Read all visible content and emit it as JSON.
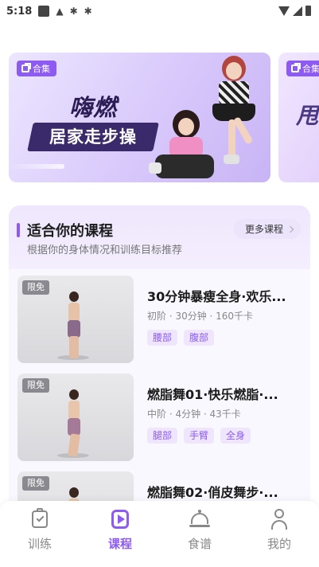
{
  "status_bar": {
    "time": "5:18"
  },
  "banners": [
    {
      "tag": "合集",
      "title": "嗨燃",
      "subtitle": "居家走步操"
    },
    {
      "tag": "合集",
      "title": "甩"
    }
  ],
  "recommend": {
    "title": "适合你的课程",
    "description": "根据你的身体情况和训练目标推荐",
    "more_label": "更多课程",
    "accent_color": "#8d5bf2",
    "items": [
      {
        "badge": "限免",
        "title": "30分钟暴瘦全身·欢乐...",
        "meta": "初阶 · 30分钟 · 160千卡",
        "tags": [
          "腰部",
          "腹部"
        ]
      },
      {
        "badge": "限免",
        "title": "燃脂舞01·快乐燃脂·...",
        "meta": "中阶 · 4分钟 · 43千卡",
        "tags": [
          "腿部",
          "手臂",
          "全身"
        ]
      },
      {
        "badge": "限免",
        "title": "燃脂舞02·俏皮舞步·...",
        "meta": "",
        "tags": []
      }
    ]
  },
  "tabbar": {
    "tabs": [
      {
        "label": "训练",
        "icon": "clipboard-check-icon"
      },
      {
        "label": "课程",
        "icon": "play-square-icon",
        "active": true
      },
      {
        "label": "食谱",
        "icon": "dish-cover-icon"
      },
      {
        "label": "我的",
        "icon": "person-icon"
      }
    ]
  }
}
